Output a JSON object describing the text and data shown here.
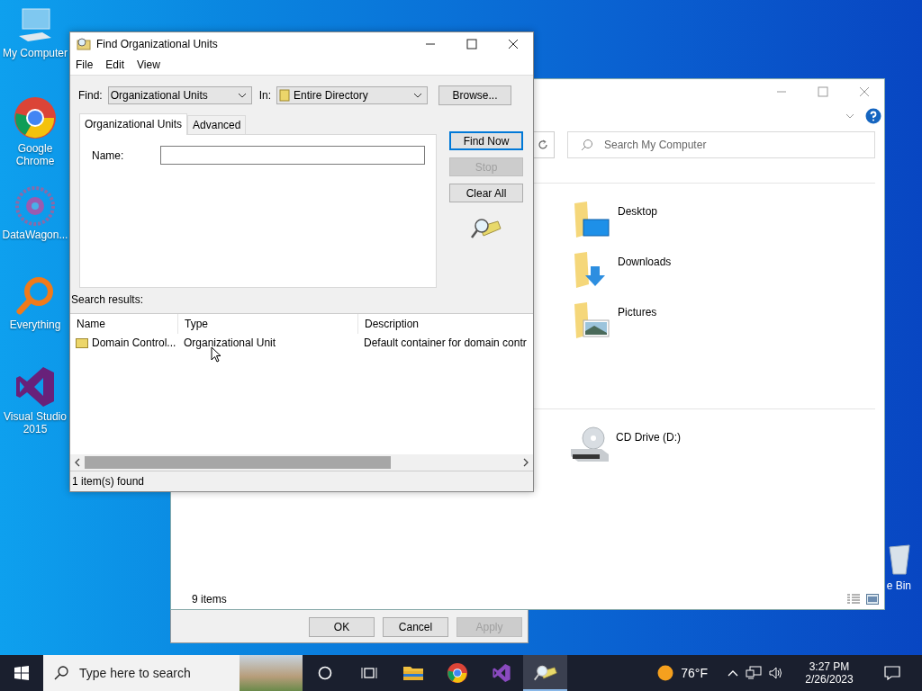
{
  "desktop_icons": [
    {
      "kind": "computer",
      "label": "My Computer"
    },
    {
      "kind": "chrome",
      "label": "Google Chrome"
    },
    {
      "kind": "datawagon",
      "label": "DataWagon..."
    },
    {
      "kind": "everything",
      "label": "Everything"
    },
    {
      "kind": "visualstudio",
      "label": "Visual Studio 2015"
    }
  ],
  "recycle_bin": {
    "label": "e Bin"
  },
  "explorer": {
    "search": {
      "placeholder": "Search My Computer"
    },
    "folders": [
      {
        "kind": "desktop",
        "label": "Desktop"
      },
      {
        "kind": "downloads",
        "label": "Downloads"
      },
      {
        "kind": "pictures",
        "label": "Pictures"
      }
    ],
    "drives": [
      {
        "kind": "cd",
        "label": "CD Drive (D:)"
      }
    ],
    "status": "9 items"
  },
  "back_dialog": {
    "buttons": [
      {
        "label": "OK",
        "disabled": false
      },
      {
        "label": "Cancel",
        "disabled": false
      },
      {
        "label": "Apply",
        "disabled": true
      }
    ]
  },
  "find_dialog": {
    "title": "Find Organizational Units",
    "menu": [
      "File",
      "Edit",
      "View"
    ],
    "find_label": "Find:",
    "find_value": "Organizational Units",
    "in_label": "In:",
    "in_value": "Entire Directory",
    "browse": "Browse...",
    "tabs": [
      {
        "label": "Organizational Units",
        "selected": true
      },
      {
        "label": "Advanced",
        "selected": false
      }
    ],
    "name_label": "Name:",
    "buttons": [
      {
        "label": "Find Now",
        "disabled": false
      },
      {
        "label": "Stop",
        "disabled": true
      },
      {
        "label": "Clear All",
        "disabled": false
      }
    ],
    "results_label": "Search results:",
    "columns": [
      "Name",
      "Type",
      "Description"
    ],
    "rows": [
      [
        "Domain Control...",
        "Organizational Unit",
        "Default container for domain contr"
      ]
    ],
    "status": "1 item(s) found"
  },
  "taskbar": {
    "search": {
      "placeholder": "Type here to search"
    },
    "apps": [
      {
        "kind": "cortana",
        "active": false
      },
      {
        "kind": "taskview",
        "active": false
      },
      {
        "kind": "explorer",
        "active": false
      },
      {
        "kind": "chrome",
        "active": false
      },
      {
        "kind": "visualstudio",
        "active": false
      },
      {
        "kind": "find",
        "active": true
      }
    ],
    "weather": "76°F",
    "time": "3:27 PM",
    "date": "2/26/2023"
  }
}
